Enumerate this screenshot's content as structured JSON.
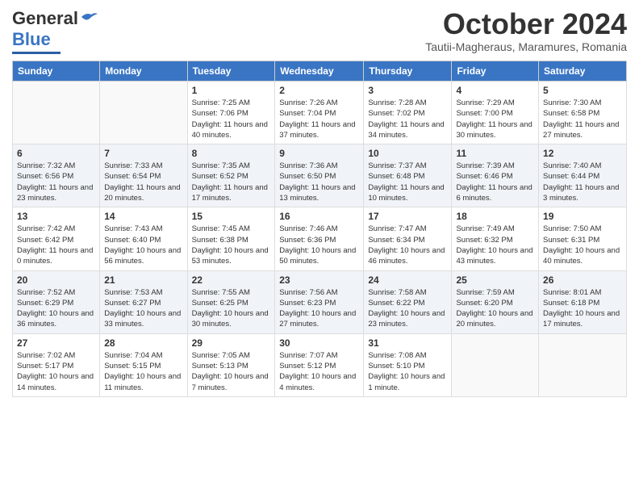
{
  "header": {
    "logo_general": "General",
    "logo_blue": "Blue",
    "month_title": "October 2024",
    "subtitle": "Tautii-Magheraus, Maramures, Romania"
  },
  "weekdays": [
    "Sunday",
    "Monday",
    "Tuesday",
    "Wednesday",
    "Thursday",
    "Friday",
    "Saturday"
  ],
  "weeks": [
    [
      {
        "day": "",
        "sunrise": "",
        "sunset": "",
        "daylight": ""
      },
      {
        "day": "",
        "sunrise": "",
        "sunset": "",
        "daylight": ""
      },
      {
        "day": "1",
        "sunrise": "Sunrise: 7:25 AM",
        "sunset": "Sunset: 7:06 PM",
        "daylight": "Daylight: 11 hours and 40 minutes."
      },
      {
        "day": "2",
        "sunrise": "Sunrise: 7:26 AM",
        "sunset": "Sunset: 7:04 PM",
        "daylight": "Daylight: 11 hours and 37 minutes."
      },
      {
        "day": "3",
        "sunrise": "Sunrise: 7:28 AM",
        "sunset": "Sunset: 7:02 PM",
        "daylight": "Daylight: 11 hours and 34 minutes."
      },
      {
        "day": "4",
        "sunrise": "Sunrise: 7:29 AM",
        "sunset": "Sunset: 7:00 PM",
        "daylight": "Daylight: 11 hours and 30 minutes."
      },
      {
        "day": "5",
        "sunrise": "Sunrise: 7:30 AM",
        "sunset": "Sunset: 6:58 PM",
        "daylight": "Daylight: 11 hours and 27 minutes."
      }
    ],
    [
      {
        "day": "6",
        "sunrise": "Sunrise: 7:32 AM",
        "sunset": "Sunset: 6:56 PM",
        "daylight": "Daylight: 11 hours and 23 minutes."
      },
      {
        "day": "7",
        "sunrise": "Sunrise: 7:33 AM",
        "sunset": "Sunset: 6:54 PM",
        "daylight": "Daylight: 11 hours and 20 minutes."
      },
      {
        "day": "8",
        "sunrise": "Sunrise: 7:35 AM",
        "sunset": "Sunset: 6:52 PM",
        "daylight": "Daylight: 11 hours and 17 minutes."
      },
      {
        "day": "9",
        "sunrise": "Sunrise: 7:36 AM",
        "sunset": "Sunset: 6:50 PM",
        "daylight": "Daylight: 11 hours and 13 minutes."
      },
      {
        "day": "10",
        "sunrise": "Sunrise: 7:37 AM",
        "sunset": "Sunset: 6:48 PM",
        "daylight": "Daylight: 11 hours and 10 minutes."
      },
      {
        "day": "11",
        "sunrise": "Sunrise: 7:39 AM",
        "sunset": "Sunset: 6:46 PM",
        "daylight": "Daylight: 11 hours and 6 minutes."
      },
      {
        "day": "12",
        "sunrise": "Sunrise: 7:40 AM",
        "sunset": "Sunset: 6:44 PM",
        "daylight": "Daylight: 11 hours and 3 minutes."
      }
    ],
    [
      {
        "day": "13",
        "sunrise": "Sunrise: 7:42 AM",
        "sunset": "Sunset: 6:42 PM",
        "daylight": "Daylight: 11 hours and 0 minutes."
      },
      {
        "day": "14",
        "sunrise": "Sunrise: 7:43 AM",
        "sunset": "Sunset: 6:40 PM",
        "daylight": "Daylight: 10 hours and 56 minutes."
      },
      {
        "day": "15",
        "sunrise": "Sunrise: 7:45 AM",
        "sunset": "Sunset: 6:38 PM",
        "daylight": "Daylight: 10 hours and 53 minutes."
      },
      {
        "day": "16",
        "sunrise": "Sunrise: 7:46 AM",
        "sunset": "Sunset: 6:36 PM",
        "daylight": "Daylight: 10 hours and 50 minutes."
      },
      {
        "day": "17",
        "sunrise": "Sunrise: 7:47 AM",
        "sunset": "Sunset: 6:34 PM",
        "daylight": "Daylight: 10 hours and 46 minutes."
      },
      {
        "day": "18",
        "sunrise": "Sunrise: 7:49 AM",
        "sunset": "Sunset: 6:32 PM",
        "daylight": "Daylight: 10 hours and 43 minutes."
      },
      {
        "day": "19",
        "sunrise": "Sunrise: 7:50 AM",
        "sunset": "Sunset: 6:31 PM",
        "daylight": "Daylight: 10 hours and 40 minutes."
      }
    ],
    [
      {
        "day": "20",
        "sunrise": "Sunrise: 7:52 AM",
        "sunset": "Sunset: 6:29 PM",
        "daylight": "Daylight: 10 hours and 36 minutes."
      },
      {
        "day": "21",
        "sunrise": "Sunrise: 7:53 AM",
        "sunset": "Sunset: 6:27 PM",
        "daylight": "Daylight: 10 hours and 33 minutes."
      },
      {
        "day": "22",
        "sunrise": "Sunrise: 7:55 AM",
        "sunset": "Sunset: 6:25 PM",
        "daylight": "Daylight: 10 hours and 30 minutes."
      },
      {
        "day": "23",
        "sunrise": "Sunrise: 7:56 AM",
        "sunset": "Sunset: 6:23 PM",
        "daylight": "Daylight: 10 hours and 27 minutes."
      },
      {
        "day": "24",
        "sunrise": "Sunrise: 7:58 AM",
        "sunset": "Sunset: 6:22 PM",
        "daylight": "Daylight: 10 hours and 23 minutes."
      },
      {
        "day": "25",
        "sunrise": "Sunrise: 7:59 AM",
        "sunset": "Sunset: 6:20 PM",
        "daylight": "Daylight: 10 hours and 20 minutes."
      },
      {
        "day": "26",
        "sunrise": "Sunrise: 8:01 AM",
        "sunset": "Sunset: 6:18 PM",
        "daylight": "Daylight: 10 hours and 17 minutes."
      }
    ],
    [
      {
        "day": "27",
        "sunrise": "Sunrise: 7:02 AM",
        "sunset": "Sunset: 5:17 PM",
        "daylight": "Daylight: 10 hours and 14 minutes."
      },
      {
        "day": "28",
        "sunrise": "Sunrise: 7:04 AM",
        "sunset": "Sunset: 5:15 PM",
        "daylight": "Daylight: 10 hours and 11 minutes."
      },
      {
        "day": "29",
        "sunrise": "Sunrise: 7:05 AM",
        "sunset": "Sunset: 5:13 PM",
        "daylight": "Daylight: 10 hours and 7 minutes."
      },
      {
        "day": "30",
        "sunrise": "Sunrise: 7:07 AM",
        "sunset": "Sunset: 5:12 PM",
        "daylight": "Daylight: 10 hours and 4 minutes."
      },
      {
        "day": "31",
        "sunrise": "Sunrise: 7:08 AM",
        "sunset": "Sunset: 5:10 PM",
        "daylight": "Daylight: 10 hours and 1 minute."
      },
      {
        "day": "",
        "sunrise": "",
        "sunset": "",
        "daylight": ""
      },
      {
        "day": "",
        "sunrise": "",
        "sunset": "",
        "daylight": ""
      }
    ]
  ]
}
